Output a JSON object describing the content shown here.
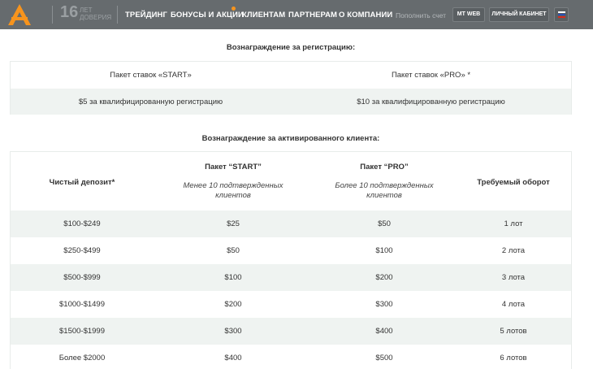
{
  "header": {
    "logo_icon": "logo-a-icon",
    "years_number": "16",
    "years_label_1": "ЛЕТ",
    "years_label_2": "ДОВЕРИЯ",
    "nav": {
      "trading": "ТРЕЙДИНГ",
      "bonuses": "БОНУСЫ И АКЦИИ",
      "clients": "КЛИЕНТАМ",
      "partners": "ПАРТНЕРАМ",
      "about": "О КОМПАНИИ"
    },
    "deposit_link": "Пополнить счет",
    "mt_web": "MT WEB",
    "cabinet": "ЛИЧНЫЙ КАБИНЕТ",
    "language_icon": "russian-flag-icon",
    "accent_color": "#f7941d"
  },
  "registration": {
    "title": "Вознаграждение за регистрацию:",
    "headers": [
      "Пакет ставок «START»",
      "Пакет ставок «PRO» *"
    ],
    "values": [
      "$5 за квалифицированную регистрацию",
      "$10 за квалифицированную регистрацию"
    ]
  },
  "activated": {
    "title": "Вознаграждение за активированного клиента:",
    "col_deposit": "Чистый депозит*",
    "col_start": "Пакет “START”",
    "col_start_sub_1": "Менее 10 подтвержденных",
    "col_start_sub_2": "клиентов",
    "col_pro": "Пакет “PRO”",
    "col_pro_sub_1": "Более 10 подтвержденных",
    "col_pro_sub_2": "клиентов",
    "col_turnover": "Требуемый оборот",
    "rows": [
      {
        "deposit": "$100-$249",
        "start": "$25",
        "pro": "$50",
        "turnover": "1 лот"
      },
      {
        "deposit": "$250-$499",
        "start": "$50",
        "pro": "$100",
        "turnover": "2 лота"
      },
      {
        "deposit": "$500-$999",
        "start": "$100",
        "pro": "$200",
        "turnover": "3 лота"
      },
      {
        "deposit": "$1000-$1499",
        "start": "$200",
        "pro": "$300",
        "turnover": "4 лота"
      },
      {
        "deposit": "$1500-$1999",
        "start": "$300",
        "pro": "$400",
        "turnover": "5 лотов"
      },
      {
        "deposit": "Более $2000",
        "start": "$400",
        "pro": "$500",
        "turnover": "6 лотов"
      }
    ]
  }
}
